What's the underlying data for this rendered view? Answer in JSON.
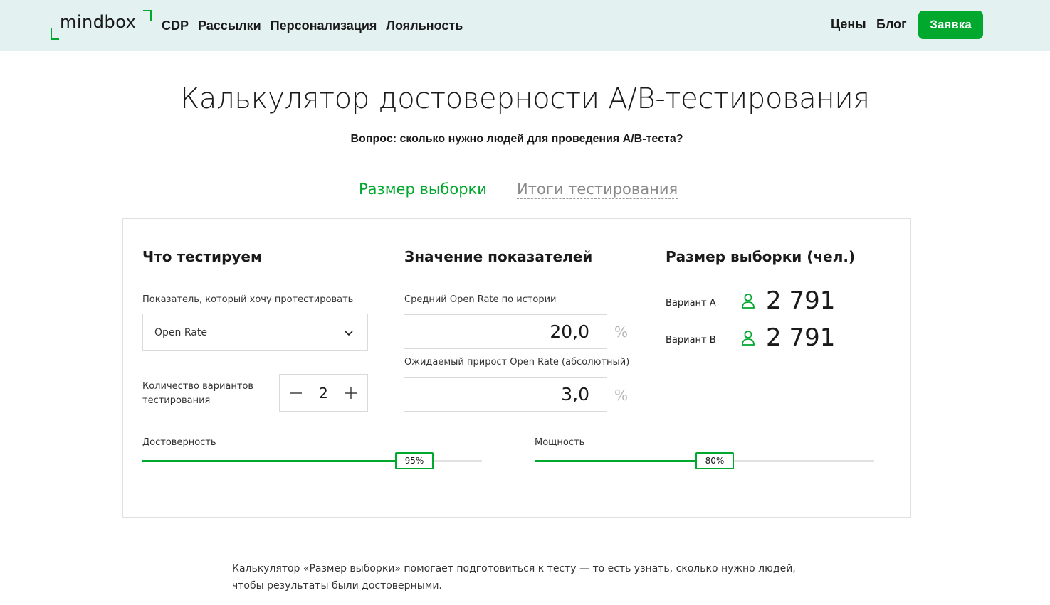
{
  "header": {
    "logo_text": "mindbox",
    "nav": [
      "CDP",
      "Рассылки",
      "Персонализация",
      "Лояльность"
    ],
    "prices_label": "Цены",
    "blog_label": "Блог",
    "cta_label": "Заявка",
    "colors": {
      "background": "#e3f2f0",
      "accent": "#00a82d"
    }
  },
  "page": {
    "title": "Калькулятор достоверности A/B-тестирования",
    "subtitle": "Вопрос: сколько нужно людей для проведения A/B-теста?"
  },
  "tabs": {
    "active": "Размер выборки",
    "inactive": "Итоги тестирования"
  },
  "what": {
    "title": "Что тестируем",
    "metric_label": "Показатель, который хочу протестировать",
    "metric_value": "Open Rate",
    "metric_icon": "chevron-down-icon",
    "variants_label": "Количество вариантов тестирования",
    "variants_value": "2",
    "decrement_icon": "minus-icon",
    "increment_icon": "plus-icon"
  },
  "values": {
    "title": "Значение показателей",
    "avg_label": "Средний Open Rate по истории",
    "avg_value": "20,0",
    "avg_unit": "%",
    "lift_label": "Ожидаемый прирост Open Rate (абсолютный)",
    "lift_value": "3,0",
    "lift_unit": "%"
  },
  "sample": {
    "title": "Размер выборки (чел.)",
    "variant_a_label": "Вариант А",
    "variant_a_value": "2 791",
    "variant_b_label": "Вариант B",
    "variant_b_value": "2 791",
    "icon": "person-icon"
  },
  "sliders": {
    "confidence_label": "Достоверность",
    "confidence_value": "95%",
    "confidence_fraction": 0.8,
    "power_label": "Мощность",
    "power_value": "80%",
    "power_fraction": 0.53
  },
  "footer": {
    "text": "Калькулятор «Размер выборки» помогает подготовиться к тесту — то есть узнать, сколько нужно людей, чтобы результаты были достоверными."
  }
}
